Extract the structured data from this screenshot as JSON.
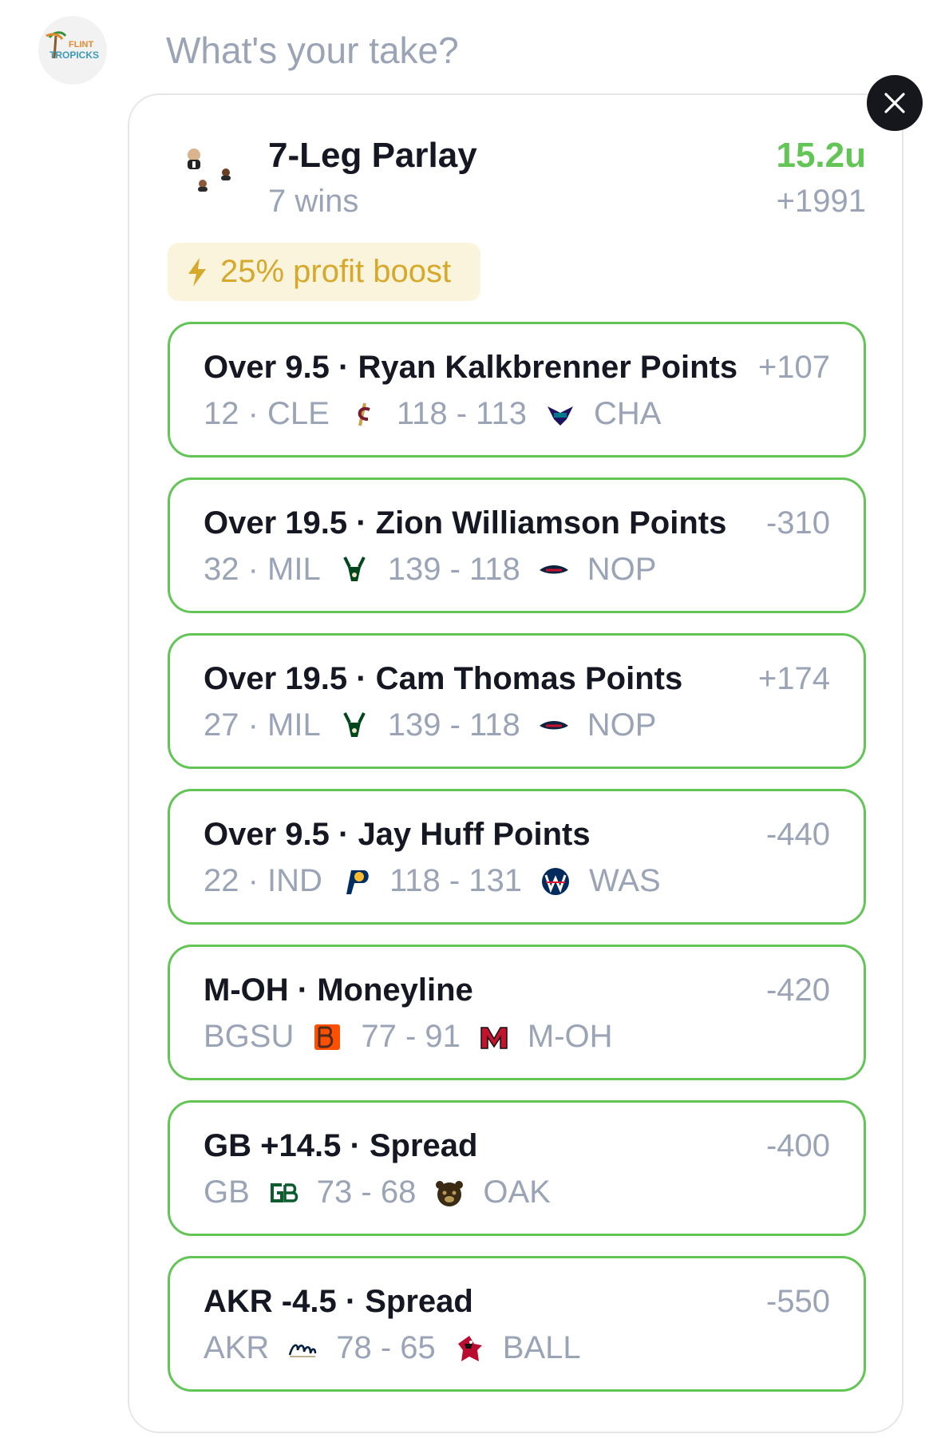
{
  "compose": {
    "placeholder": "What's your take?"
  },
  "avatar": {
    "brand_top": "FLINT",
    "brand_bottom": "TROPICKS"
  },
  "parlay": {
    "title": "7-Leg Parlay",
    "subtitle": "7 wins",
    "units": "15.2u",
    "odds": "+1991",
    "boost": "25% profit boost"
  },
  "colors": {
    "win_green": "#62c556",
    "muted": "#9aa4b6",
    "boost_bg": "#fbf4dc",
    "boost_text": "#d6a82b"
  },
  "legs": [
    {
      "title": "Over 9.5 · Ryan Kalkbrenner Points",
      "odds": "+107",
      "stat": "12 · CLE",
      "score": "118 - 113",
      "opponent": "CHA",
      "logo1": "cavaliers-logo-icon",
      "logo2": "hornets-logo-icon"
    },
    {
      "title": "Over 19.5 · Zion Williamson Points",
      "odds": "-310",
      "stat": "32 · MIL",
      "score": "139 - 118",
      "opponent": "NOP",
      "logo1": "bucks-logo-icon",
      "logo2": "pelicans-logo-icon"
    },
    {
      "title": "Over 19.5 · Cam Thomas Points",
      "odds": "+174",
      "stat": "27 · MIL",
      "score": "139 - 118",
      "opponent": "NOP",
      "logo1": "bucks-logo-icon",
      "logo2": "pelicans-logo-icon"
    },
    {
      "title": "Over 9.5 · Jay Huff Points",
      "odds": "-440",
      "stat": "22 · IND",
      "score": "118 - 131",
      "opponent": "WAS",
      "logo1": "pacers-logo-icon",
      "logo2": "wizards-logo-icon"
    },
    {
      "title": "M-OH · Moneyline",
      "odds": "-420",
      "stat": "BGSU",
      "score": "77 - 91",
      "opponent": "M-OH",
      "logo1": "bgsu-logo-icon",
      "logo2": "miami-ohio-logo-icon"
    },
    {
      "title": "GB +14.5 · Spread",
      "odds": "-400",
      "stat": "GB",
      "score": "73 - 68",
      "opponent": "OAK",
      "logo1": "green-bay-logo-icon",
      "logo2": "oakland-logo-icon"
    },
    {
      "title": "AKR -4.5 · Spread",
      "odds": "-550",
      "stat": "AKR",
      "score": "78 - 65",
      "opponent": "BALL",
      "logo1": "akron-logo-icon",
      "logo2": "ball-state-logo-icon"
    }
  ]
}
